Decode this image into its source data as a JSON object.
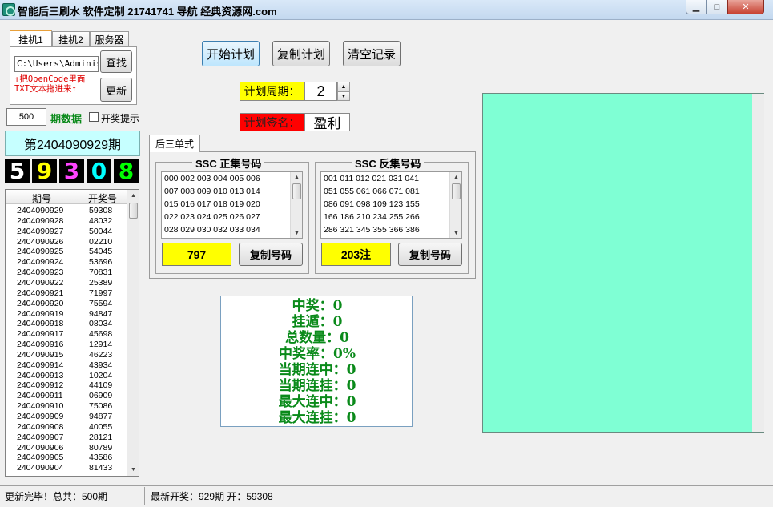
{
  "window": {
    "title": "智能后三刷水 软件定制 21741741 导航 经典资源网.com",
    "min_label": "▁",
    "max_label": "□",
    "close_label": "✕"
  },
  "tabs": [
    {
      "label": "挂机1",
      "active": true
    },
    {
      "label": "挂机2",
      "active": false
    },
    {
      "label": "服务器",
      "active": false
    }
  ],
  "import": {
    "path_value": "C:\\Users\\Administ",
    "find_label": "查找",
    "update_label": "更新",
    "hint_line1": "↑把OpenCode里面",
    "hint_line2": "TXT文本拖进来↑"
  },
  "period": {
    "count_value": "500",
    "count_label": "期数据",
    "notify_label": "开奖提示"
  },
  "current_issue": "第2404090929期",
  "current_digits": [
    {
      "d": "5",
      "color": "#ffffff"
    },
    {
      "d": "9",
      "color": "#ffff00"
    },
    {
      "d": "3",
      "color": "#ff44ff"
    },
    {
      "d": "0",
      "color": "#00ffff"
    },
    {
      "d": "8",
      "color": "#00ff00"
    }
  ],
  "history": {
    "col_issue": "期号",
    "col_number": "开奖号",
    "rows": [
      [
        "2404090929",
        "59308"
      ],
      [
        "2404090928",
        "48032"
      ],
      [
        "2404090927",
        "50044"
      ],
      [
        "2404090926",
        "02210"
      ],
      [
        "2404090925",
        "54045"
      ],
      [
        "2404090924",
        "53696"
      ],
      [
        "2404090923",
        "70831"
      ],
      [
        "2404090922",
        "25389"
      ],
      [
        "2404090921",
        "71997"
      ],
      [
        "2404090920",
        "75594"
      ],
      [
        "2404090919",
        "94847"
      ],
      [
        "2404090918",
        "08034"
      ],
      [
        "2404090917",
        "45698"
      ],
      [
        "2404090916",
        "12914"
      ],
      [
        "2404090915",
        "46223"
      ],
      [
        "2404090914",
        "43934"
      ],
      [
        "2404090913",
        "10204"
      ],
      [
        "2404090912",
        "44109"
      ],
      [
        "2404090911",
        "06909"
      ],
      [
        "2404090910",
        "75086"
      ],
      [
        "2404090909",
        "94877"
      ],
      [
        "2404090908",
        "40055"
      ],
      [
        "2404090907",
        "28121"
      ],
      [
        "2404090906",
        "80789"
      ],
      [
        "2404090905",
        "43586"
      ],
      [
        "2404090904",
        "81433"
      ]
    ]
  },
  "toolbar": {
    "start_label": "开始计划",
    "copy_plan_label": "复制计划",
    "clear_label": "清空记录"
  },
  "plan": {
    "cycle_label": "计划周期：",
    "cycle_value": "2",
    "sign_label": "计划签名：",
    "sign_value": "盈利"
  },
  "mode_tab": "后三单式",
  "positive": {
    "title": "SSC 正集号码",
    "lines": [
      "000 002 003 004 005 006",
      "007 008 009 010 013 014",
      "015 016 017 018 019 020",
      "022 023 024 025 026 027",
      "028 029 030 032 033 034"
    ],
    "count": "797",
    "copy_label": "复制号码"
  },
  "negative": {
    "title": "SSC 反集号码",
    "lines": [
      "001 011 012 021 031 041",
      "051 055 061 066 071 081",
      "086 091 098 109 123 155",
      "166 186 210 234 255 266",
      "286 321 345 355 366 386"
    ],
    "count": "203注",
    "copy_label": "复制号码"
  },
  "stats": [
    "中奖：0",
    "挂遁：0",
    "总数量：0",
    "中奖率：0%",
    "当期连中：0",
    "当期连挂：0",
    "最大连中：0",
    "最大连挂：0"
  ],
  "status": {
    "left": "更新完毕！总共：500期",
    "right": "最新开奖：929期 开：59308"
  },
  "colors": {
    "plan_area": "#7fffd4",
    "stats_text": "#0a8a1a",
    "cycle_label_bg": "#ffff00",
    "sign_label_bg": "#ff0000"
  }
}
